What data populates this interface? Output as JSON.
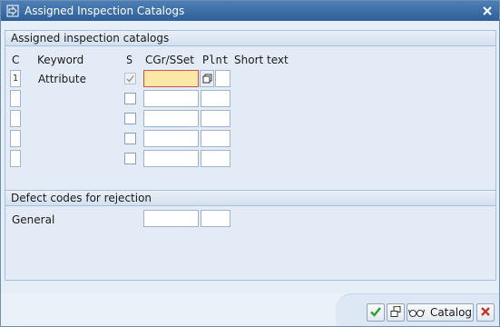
{
  "window": {
    "title": "Assigned Inspection Catalogs"
  },
  "catalogs_group": {
    "title": "Assigned inspection catalogs",
    "columns": {
      "c": "C",
      "keyword": "Keyword",
      "s": "S",
      "cgr": "CGr/SSet",
      "plnt": "Plnt",
      "short_text": "Short text"
    },
    "rows": [
      {
        "c": "1",
        "keyword": "Attribute",
        "s_checked": true,
        "cgr": "",
        "plnt": ""
      },
      {
        "c": "",
        "keyword": "",
        "s_checked": false,
        "cgr": "",
        "plnt": ""
      },
      {
        "c": "",
        "keyword": "",
        "s_checked": false,
        "cgr": "",
        "plnt": ""
      },
      {
        "c": "",
        "keyword": "",
        "s_checked": false,
        "cgr": "",
        "plnt": ""
      },
      {
        "c": "",
        "keyword": "",
        "s_checked": false,
        "cgr": "",
        "plnt": ""
      }
    ]
  },
  "defects_group": {
    "title": "Defect codes for rejection",
    "general_label": "General",
    "cgr_value": "",
    "plnt_value": ""
  },
  "footer": {
    "catalog_label": "Catalog",
    "icons": [
      "confirm-icon",
      "copy-icon",
      "glasses-icon",
      "cancel-icon"
    ],
    "confirm_color": "#2f9e2f",
    "cancel_color": "#c0392b"
  }
}
